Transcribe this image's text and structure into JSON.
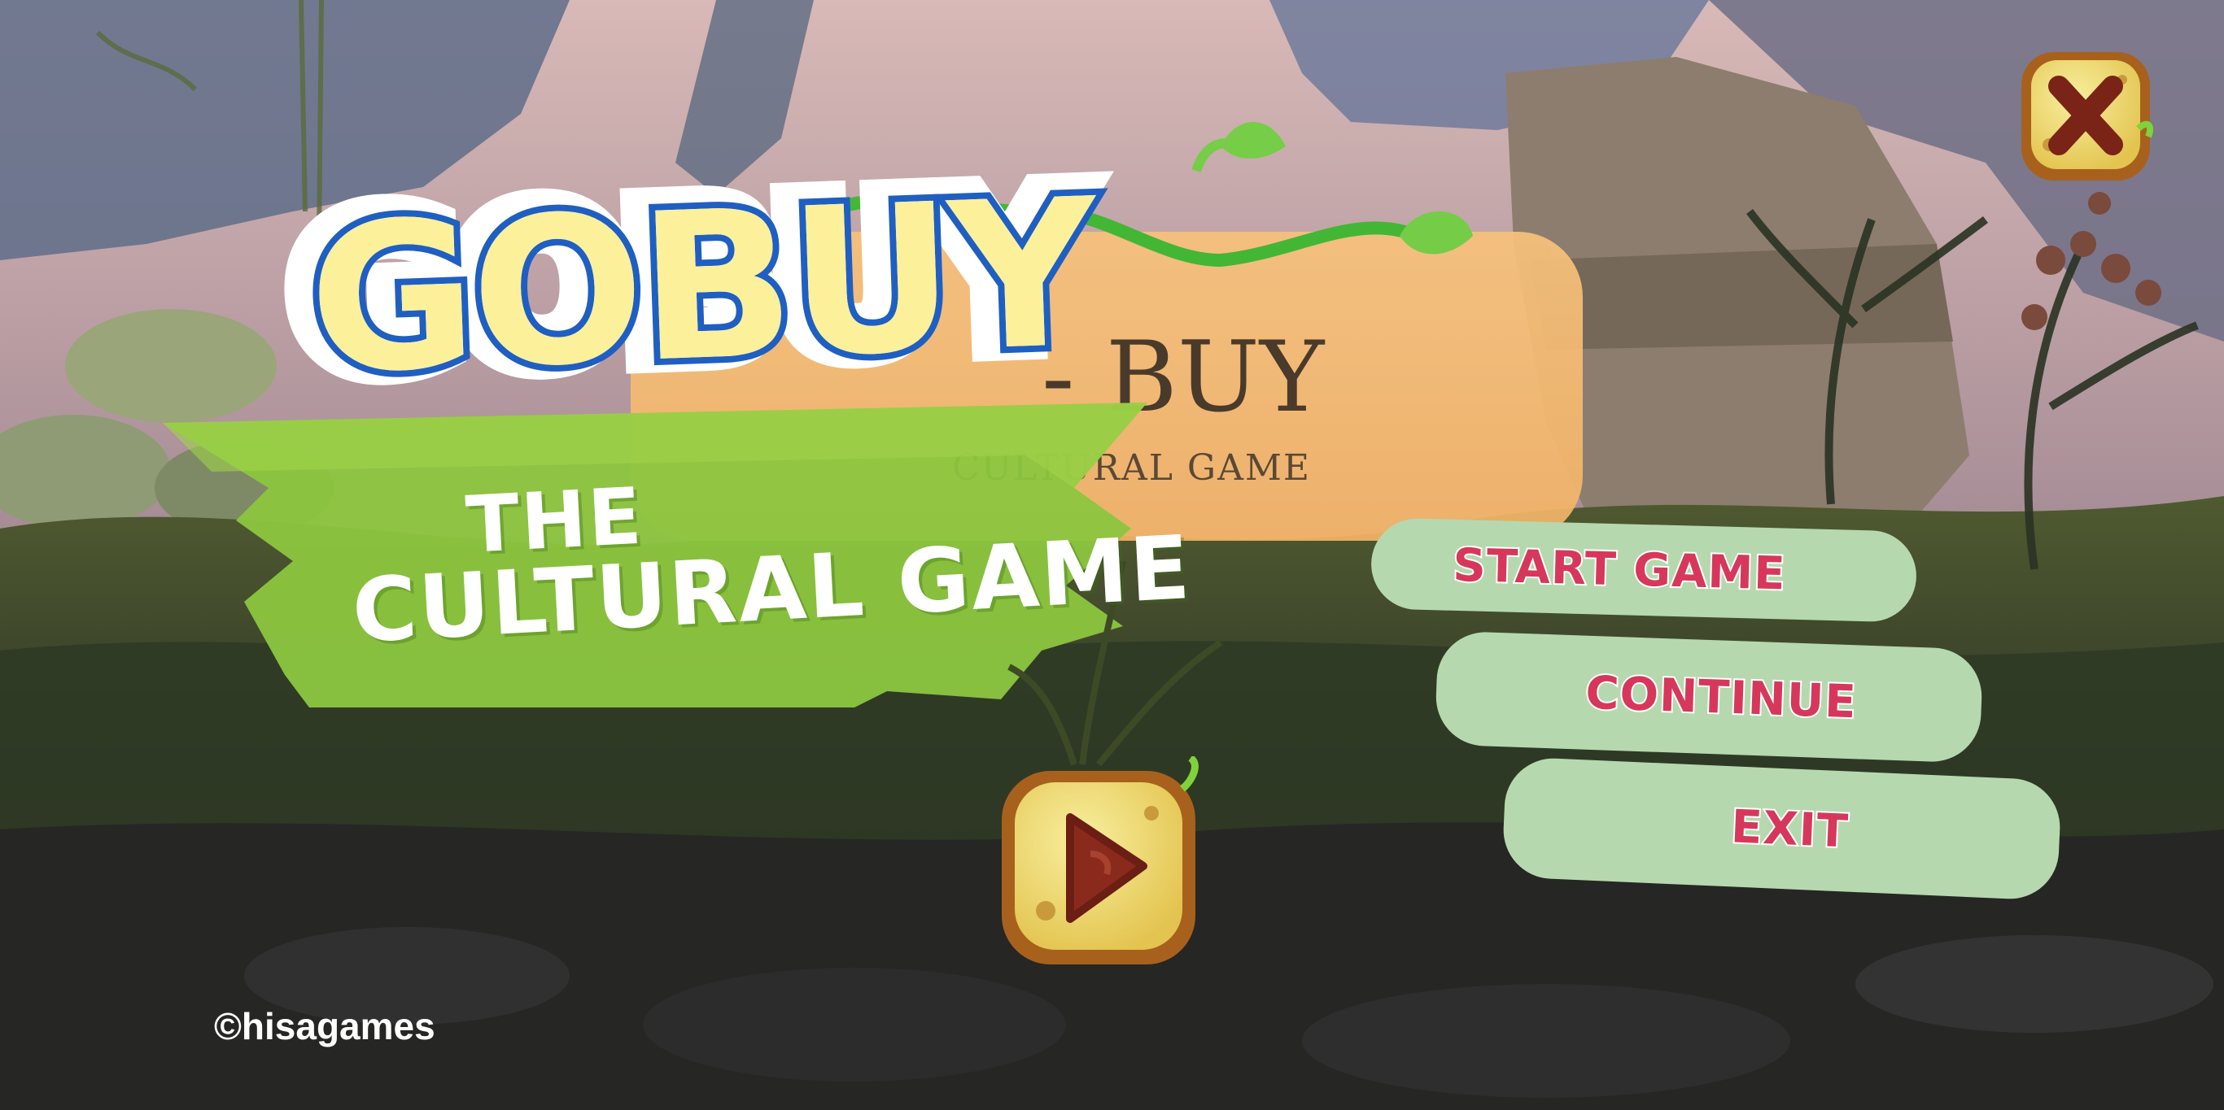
{
  "game": {
    "logo_text": "GOBUY",
    "tagline_line1": "THE",
    "tagline_line2": "CULTURAL GAME",
    "background_sign_title": "- BUY",
    "background_sign_subtitle": "CULTURAL GAME"
  },
  "menu": {
    "start_label": "START GAME",
    "continue_label": "CONTINUE",
    "exit_label": "EXIT"
  },
  "icons": {
    "close": "close-icon",
    "play": "play-icon"
  },
  "footer": {
    "copyright": "©hisagames"
  },
  "colors": {
    "menu_button_bg": "#b6d8ae",
    "menu_text": "#d7375b",
    "logo_fill": "#fdf09a",
    "logo_outline": "#1f5fc2",
    "banner_green": "#8cc63f"
  }
}
